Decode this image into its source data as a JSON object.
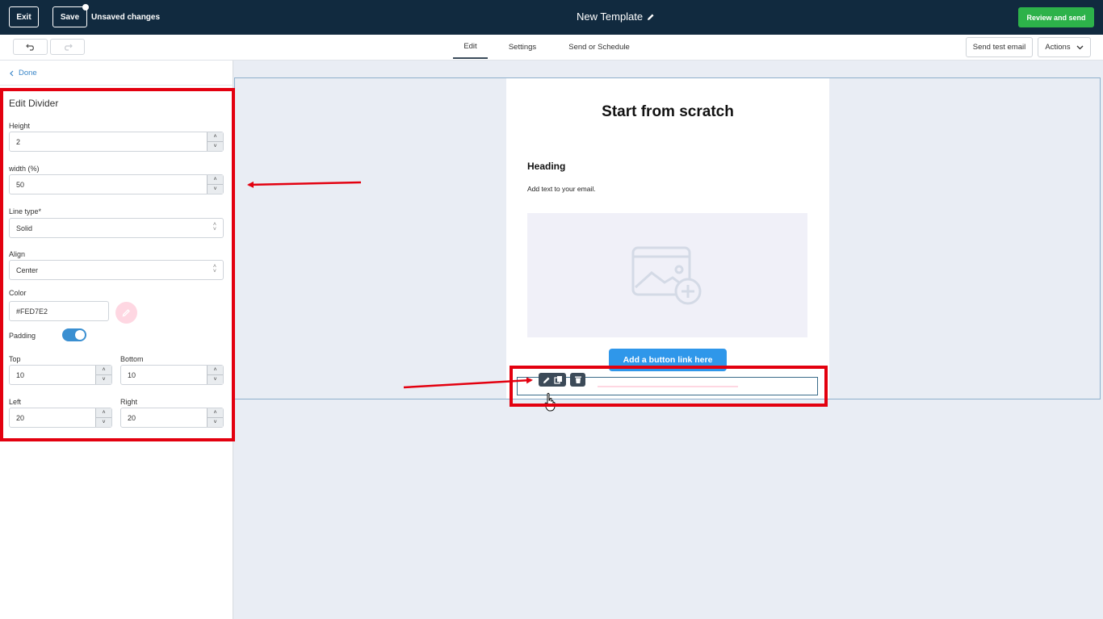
{
  "topbar": {
    "exit_label": "Exit",
    "save_label": "Save",
    "unsaved_text": "Unsaved changes",
    "template_title": "New Template",
    "review_label": "Review and send"
  },
  "subbar": {
    "tabs": [
      {
        "label": "Edit"
      },
      {
        "label": "Settings"
      },
      {
        "label": "Send or Schedule"
      }
    ],
    "send_test_label": "Send test email",
    "actions_label": "Actions"
  },
  "panel": {
    "done_label": "Done",
    "title": "Edit Divider",
    "height": {
      "label": "Height",
      "value": "2"
    },
    "width": {
      "label": "width (%)",
      "value": "50"
    },
    "line_type": {
      "label": "Line type*",
      "value": "Solid"
    },
    "align": {
      "label": "Align",
      "value": "Center"
    },
    "color": {
      "label": "Color",
      "value": "#FED7E2"
    },
    "padding": {
      "label": "Padding",
      "enabled": true
    },
    "top": {
      "label": "Top",
      "value": "10"
    },
    "bottom": {
      "label": "Bottom",
      "value": "10"
    },
    "left": {
      "label": "Left",
      "value": "20"
    },
    "right": {
      "label": "Right",
      "value": "20"
    }
  },
  "email": {
    "title": "Start from scratch",
    "heading": "Heading",
    "body_text": "Add text to your email.",
    "button_label": "Add a button link here"
  },
  "colors": {
    "topbar_bg": "#112a3f",
    "review_green": "#2db24a",
    "accent_blue": "#3a8fd1",
    "divider_color": "#FED7E2",
    "annotation_red": "#e3000f"
  }
}
